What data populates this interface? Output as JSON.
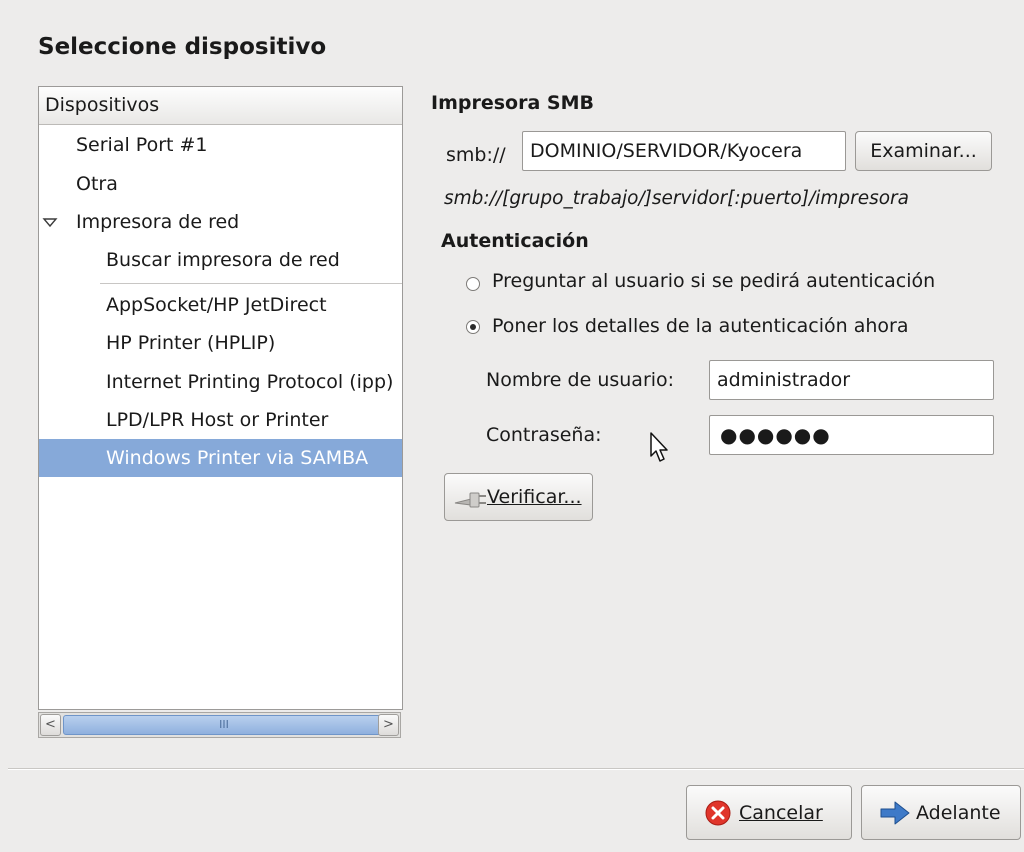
{
  "dialog": {
    "title": "Seleccione dispositivo"
  },
  "device_list": {
    "header": "Dispositivos",
    "items": [
      {
        "label": "Serial Port #1"
      },
      {
        "label": "Otra"
      },
      {
        "label": "Impresora de red",
        "expanded": true
      },
      {
        "label": "Buscar impresora de red"
      },
      {
        "label": "AppSocket/HP JetDirect"
      },
      {
        "label": "HP Printer (HPLIP)"
      },
      {
        "label": "Internet Printing Protocol (ipp)"
      },
      {
        "label": "LPD/LPR Host or Printer"
      },
      {
        "label": "Windows Printer via SAMBA",
        "selected": true
      }
    ],
    "scrollbar": {
      "left_arrow": "<",
      "right_arrow": ">",
      "thumb_grip": "III"
    }
  },
  "smb": {
    "section_title": "Impresora SMB",
    "prefix": "smb://",
    "uri_value": "DOMINIO/SERVIDOR/Kyocera",
    "browse_label": "Examinar...",
    "hint": "smb://[grupo_trabajo/]servidor[:puerto]/impresora"
  },
  "auth": {
    "section_title": "Autenticación",
    "option_ask": "Preguntar al usuario si se pedirá autenticación",
    "option_now": "Poner los detalles de la autenticación ahora",
    "selected_option": "option_now",
    "username_label": "Nombre de usuario:",
    "username_value": "administrador",
    "password_label": "Contraseña:",
    "password_mask": "●●●●●●",
    "verify_label": "Verificar..."
  },
  "footer": {
    "cancel_label": "Cancelar",
    "forward_label": "Adelante"
  },
  "colors": {
    "selection": "#86a9d9",
    "window_bg": "#edeceb"
  }
}
